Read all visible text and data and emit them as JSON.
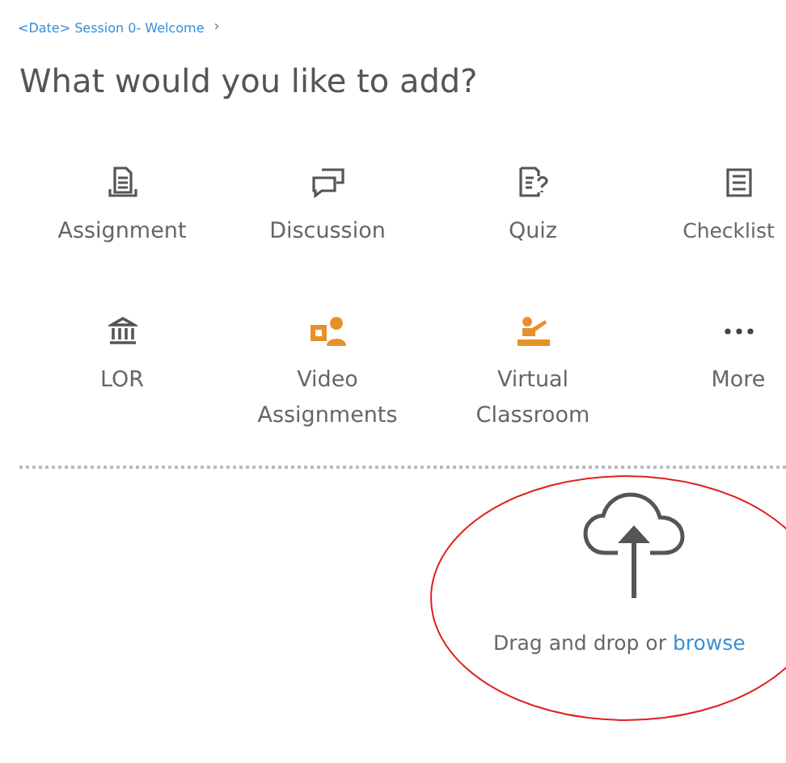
{
  "breadcrumb": {
    "link": "<Date> Session 0- Welcome",
    "separator": "›"
  },
  "heading": "What would you like to add?",
  "items": [
    {
      "label": "Assignment"
    },
    {
      "label": "Discussion"
    },
    {
      "label": "Quiz"
    },
    {
      "label": "Checklist"
    },
    {
      "label": "LOR"
    },
    {
      "label": "Video Assignments"
    },
    {
      "label": "Virtual Classroom"
    },
    {
      "label": "More"
    }
  ],
  "upload": {
    "text": "Drag and drop or",
    "link": "browse"
  }
}
